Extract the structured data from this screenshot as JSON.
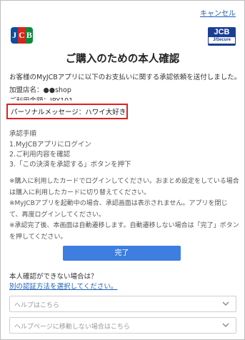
{
  "header": {
    "cancel_label": "キャンセル",
    "logo_text": "JCB",
    "secure_logo_main": "JCB",
    "secure_logo_sub": "J/Secure"
  },
  "title": "ご購入のための本人確認",
  "intro": "お客様のMyJCBアプリに以下のお支払いに関する承認依頼を送付しました。",
  "merchant": "加盟店名：●●shop",
  "amount": "ご利用金額：JPY101",
  "personal_message": "パーソナルメッセージ：ハワイ大好き",
  "steps": {
    "heading": "承認手順",
    "items": [
      "1.MyJCBアプリにログイン",
      "2.ご利用内容を確認",
      "3.「この決済を承認する」ボタンを押下"
    ]
  },
  "notes": [
    "※購入に利用したカードでログインしてください。おまとめ設定をしている場合は購入に利用したカードに切り替えてください。",
    "※MyJCBアプリを起動中の場合、承認画面は表示されません。アプリを閉じて、再度ログインしてください。",
    "※承認完了後、本画面は自動遷移します。自動遷移しない場合は「完了」ボタンを押してください。"
  ],
  "done_label": "完了",
  "alt": {
    "question": "本人確認ができない場合は？",
    "link": "別の認証方法を選択してください。"
  },
  "dropdowns": [
    "ヘルプはこちら",
    "ヘルプページに移動しない場合はこちら"
  ],
  "colors": {
    "accent": "#3d7ee0",
    "link": "#1a5fb4",
    "highlight_border": "#e02020"
  }
}
